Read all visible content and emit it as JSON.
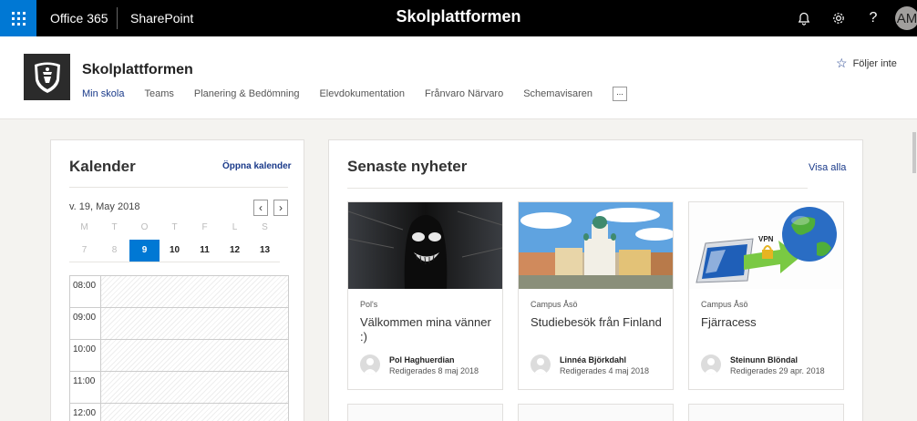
{
  "suitebar": {
    "brand": "Office 365",
    "app": "SharePoint",
    "title": "Skolplattformen",
    "icons": [
      "waffle-icon",
      "bell-icon",
      "gear-icon",
      "help-icon"
    ],
    "avatar_initials": "AM",
    "accent": "#0078d4"
  },
  "site": {
    "title": "Skolplattformen",
    "nav": [
      "Min skola",
      "Teams",
      "Planering & Bedömning",
      "Elevdokumentation",
      "Frånvaro Närvaro",
      "Schemavisaren"
    ],
    "nav_more": "...",
    "follow_label": "Följer inte"
  },
  "calendar": {
    "title": "Kalender",
    "open_link": "Öppna kalender",
    "week_label": "v. 19, May 2018",
    "weekdays": [
      "M",
      "T",
      "O",
      "T",
      "F",
      "L",
      "S"
    ],
    "dates": [
      "7",
      "8",
      "9",
      "10",
      "11",
      "12",
      "13"
    ],
    "selected_date": "9",
    "times": [
      "08:00",
      "09:00",
      "10:00",
      "11:00",
      "12:00"
    ]
  },
  "news": {
    "title": "Senaste nyheter",
    "show_all": "Visa alla",
    "items": [
      {
        "category": "Pol's",
        "headline": "Välkommen mina vänner :)",
        "author": "Pol Haghuerdian",
        "edited": "Redigerades 8 maj 2018"
      },
      {
        "category": "Campus Åsö",
        "headline": "Studiebesök från Finland",
        "author": "Linnéa Björkdahl",
        "edited": "Redigerades 4 maj 2018"
      },
      {
        "category": "Campus Åsö",
        "headline": "Fjärracess",
        "author": "Steinunn Blöndal",
        "edited": "Redigerades 29 apr. 2018",
        "image_text": "VPN"
      }
    ]
  }
}
